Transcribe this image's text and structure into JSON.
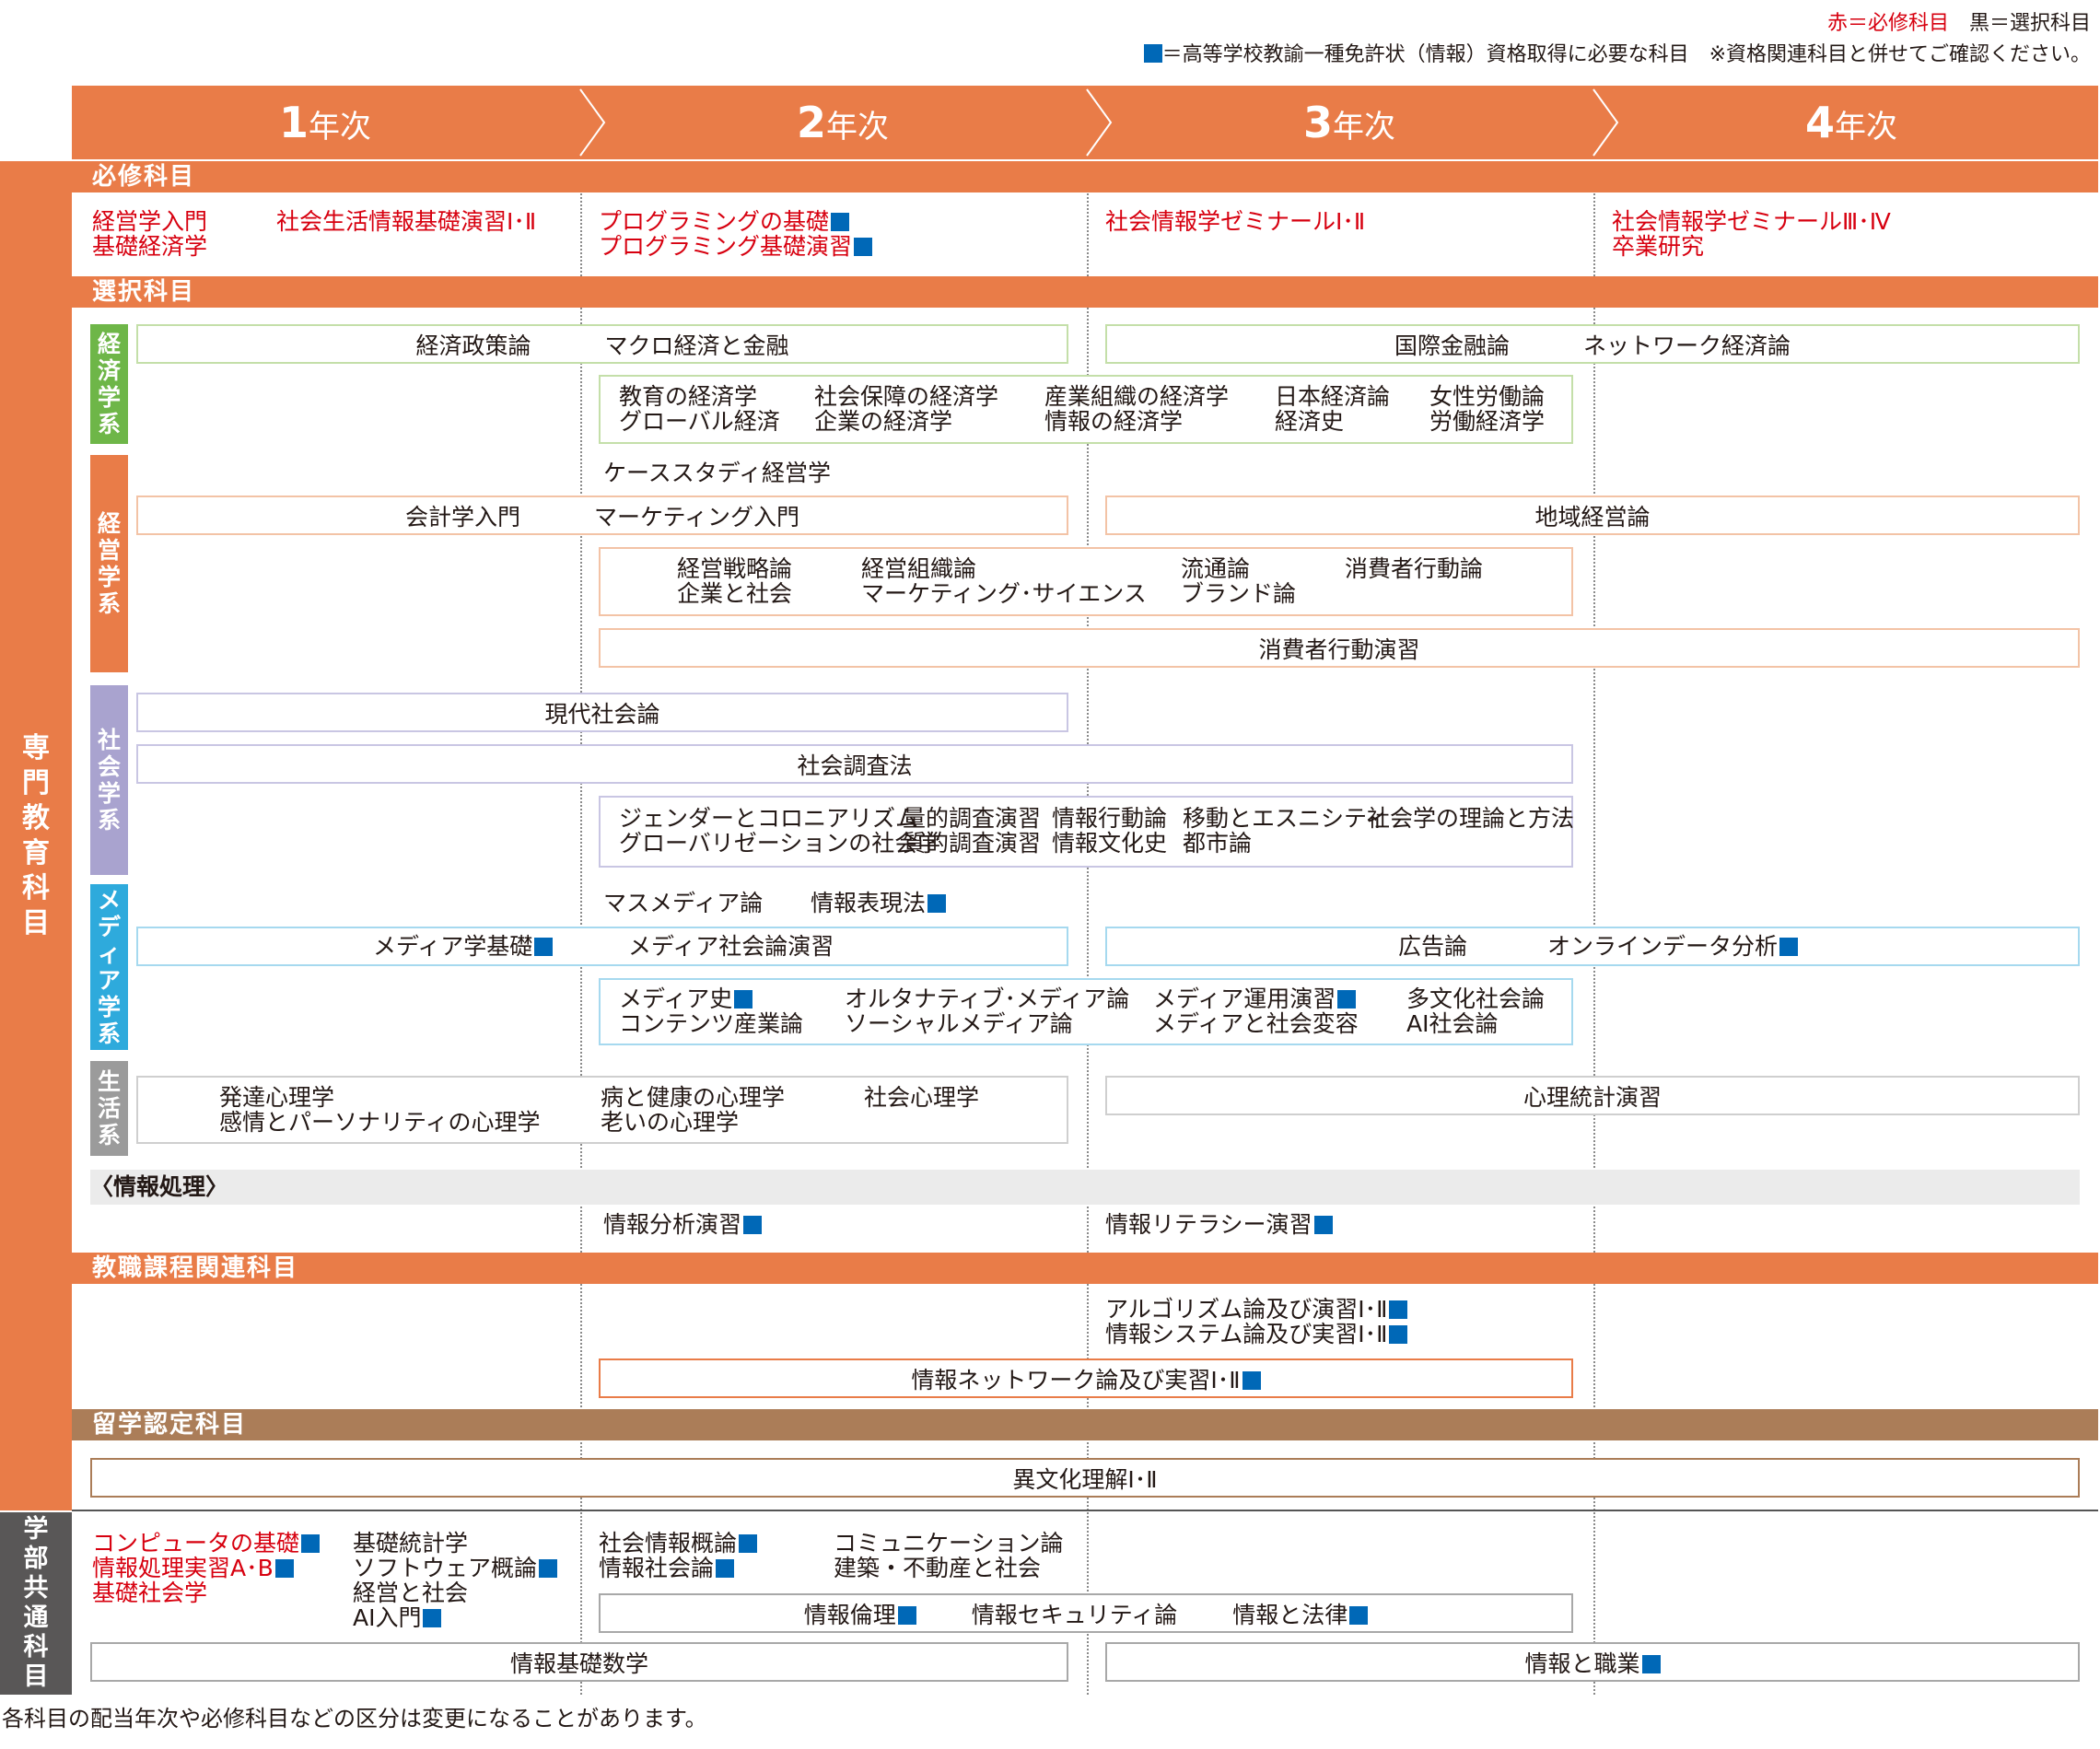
{
  "legend": {
    "line1_red": "赤＝必修科目",
    "line1_black": "黒＝選択科目",
    "line2": "＝高等学校教諭一種免許状（情報）資格取得に必要な科目　※資格関連科目と併せてご確認ください。"
  },
  "years": [
    {
      "num": "1",
      "label": "年次"
    },
    {
      "num": "2",
      "label": "年次"
    },
    {
      "num": "3",
      "label": "年次"
    },
    {
      "num": "4",
      "label": "年次"
    }
  ],
  "side": {
    "specialized": "専門教育科目",
    "common": "学部共通科目"
  },
  "colors": {
    "orange": "#e97c48",
    "brown": "#ab7d58",
    "green": "#6eb648",
    "blue": "#2eaadc",
    "purple": "#a9a3cf",
    "gray": "#9b9b9b",
    "red": "#d7000f",
    "square": "#0068b7"
  },
  "sections": {
    "required": "必修科目",
    "elective": "選択科目",
    "info": "〈情報処理〉",
    "teacher": "教職課程関連科目",
    "abroad": "留学認定科目"
  },
  "categories": {
    "econ": "経済学系",
    "mgmt": "経営学系",
    "soc": "社会学系",
    "media": "メディア学系",
    "life": "生活系"
  },
  "required": {
    "y1": [
      "経営学入門",
      "基礎経済学",
      "社会生活情報基礎演習Ⅰ･Ⅱ"
    ],
    "y2": [
      "プログラミングの基礎",
      "プログラミング基礎演習"
    ],
    "y3": [
      "社会情報学ゼミナールⅠ･Ⅱ"
    ],
    "y4": [
      "社会情報学ゼミナールⅢ･Ⅳ",
      "卒業研究"
    ]
  },
  "econ": {
    "b1": [
      "経済政策論",
      "マクロ経済と金融"
    ],
    "b2": [
      "国際金融論",
      "ネットワーク経済論"
    ],
    "b3": [
      "教育の経済学",
      "グローバル経済",
      "社会保障の経済学",
      "企業の経済学",
      "産業組織の経済学",
      "情報の経済学",
      "日本経済論",
      "経済史",
      "女性労働論",
      "労働経済学"
    ]
  },
  "mgmt": {
    "case": "ケーススタディ経営学",
    "b1": [
      "会計学入門",
      "マーケティング入門"
    ],
    "b2": "地域経営論",
    "b3": [
      "経営戦略論",
      "企業と社会",
      "経営組織論",
      "マーケティング･サイエンス",
      "流通論",
      "ブランド論",
      "消費者行動論"
    ],
    "b4": "消費者行動演習"
  },
  "soc": {
    "b1": "現代社会論",
    "b2": "社会調査法",
    "b3": [
      "ジェンダーとコロニアリズム",
      "グローバリゼーションの社会学",
      "量的調査演習",
      "質的調査演習",
      "情報行動論",
      "情報文化史",
      "移動とエスニシティ",
      "都市論",
      "社会学の理論と方法"
    ]
  },
  "media": {
    "top": [
      "マスメディア論",
      "情報表現法"
    ],
    "b1": [
      "メディア学基礎",
      "メディア社会論演習"
    ],
    "b2": [
      "広告論",
      "オンラインデータ分析"
    ],
    "b3": [
      "メディア史",
      "コンテンツ産業論",
      "オルタナティブ･メディア論",
      "ソーシャルメディア論",
      "メディア運用演習",
      "メディアと社会変容",
      "多文化社会論",
      "AI社会論"
    ]
  },
  "life": {
    "b1": [
      "発達心理学",
      "感情とパーソナリティの心理学",
      "病と健康の心理学",
      "老いの心理学",
      "社会心理学"
    ],
    "b2": "心理統計演習"
  },
  "info": [
    "情報分析演習",
    "情報リテラシー演習"
  ],
  "teacher": {
    "t1": "アルゴリズム論及び演習Ⅰ･Ⅱ",
    "t2": "情報システム論及び実習Ⅰ･Ⅱ",
    "b1": "情報ネットワーク論及び実習Ⅰ･Ⅱ"
  },
  "abroad": {
    "b1": "異文化理解Ⅰ･Ⅱ"
  },
  "common": {
    "y1red": [
      "コンピュータの基礎",
      "情報処理実習A･B",
      "基礎社会学"
    ],
    "y1": [
      "基礎統計学",
      "ソフトウェア概論",
      "経営と社会",
      "AI入門"
    ],
    "y2": [
      "社会情報概論",
      "情報社会論",
      "コミュニケーション論",
      "建築・不動産と社会"
    ],
    "b1": [
      "情報倫理",
      "情報セキュリティ論",
      "情報と法律"
    ],
    "b2": "情報基礎数学",
    "b3": "情報と職業"
  },
  "footnote": "各科目の配当年次や必修科目などの区分は変更になることがあります。"
}
